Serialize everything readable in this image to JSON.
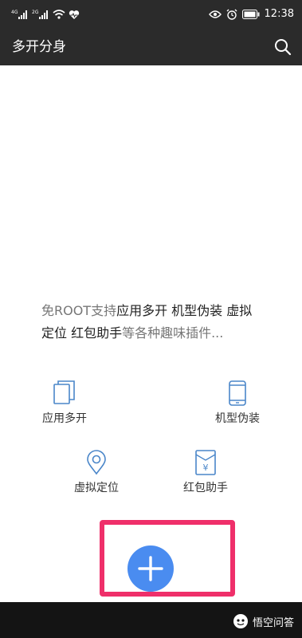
{
  "status_bar": {
    "sim1": "4G",
    "sim2": "2G",
    "time": "12:38"
  },
  "app_bar": {
    "title": "多开分身"
  },
  "main": {
    "description_parts": [
      "免ROOT支持",
      "应用多开 机型伪装 虚拟定位 红包助手",
      "等各种趣味插件..."
    ],
    "features": [
      {
        "label": "应用多开",
        "icon": "copy-icon"
      },
      {
        "label": "机型伪装",
        "icon": "phone-icon"
      },
      {
        "label": "虚拟定位",
        "icon": "location-icon"
      },
      {
        "label": "红包助手",
        "icon": "red-envelope-icon"
      }
    ]
  },
  "fab": {
    "icon": "plus-icon"
  },
  "watermark": {
    "text": "悟空问答"
  },
  "colors": {
    "bar_bg": "#2b2b2b",
    "accent_blue": "#4a8cf0",
    "highlight_pink": "#ef2f6a",
    "icon_blue": "#4a86c9"
  }
}
